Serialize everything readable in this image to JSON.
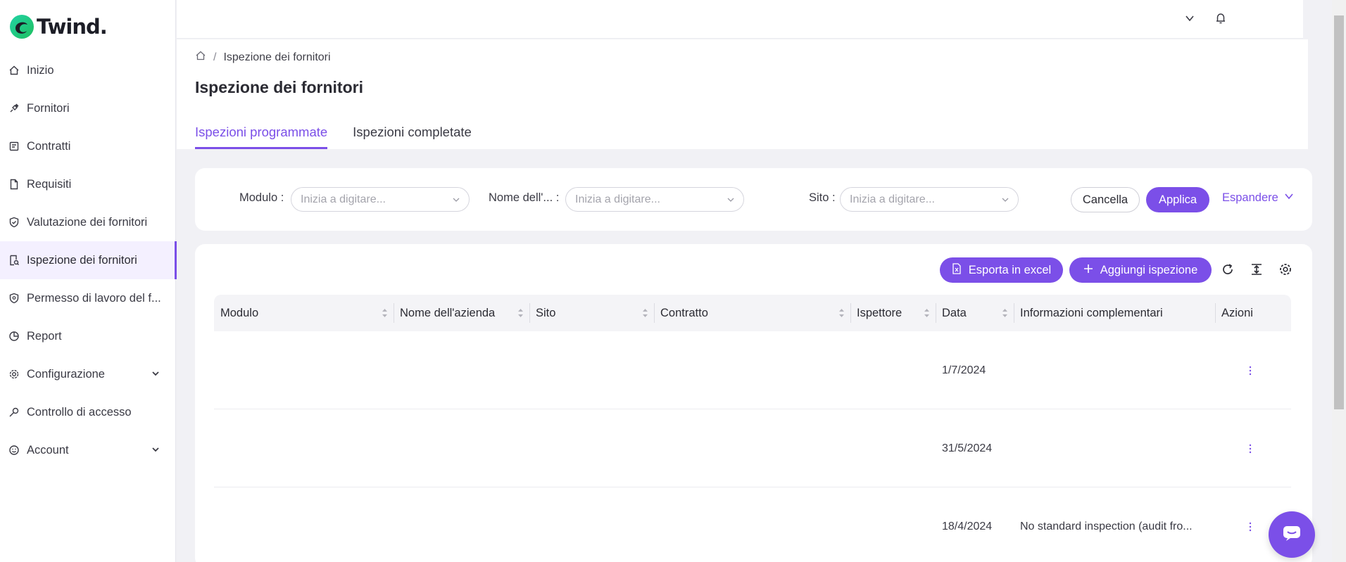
{
  "brand": {
    "name": "Twind.",
    "accent": "#7b4fe8"
  },
  "sidebar": {
    "items": [
      {
        "label": "Inizio",
        "icon": "home-icon"
      },
      {
        "label": "Fornitori",
        "icon": "plug-icon"
      },
      {
        "label": "Contratti",
        "icon": "document-icon"
      },
      {
        "label": "Requisiti",
        "icon": "file-icon"
      },
      {
        "label": "Valutazione dei fornitori",
        "icon": "shield-check-icon"
      },
      {
        "label": "Ispezione dei fornitori",
        "icon": "search-doc-icon",
        "active": true
      },
      {
        "label": "Permesso di lavoro del f...",
        "icon": "shield-icon"
      },
      {
        "label": "Report",
        "icon": "pie-chart-icon"
      },
      {
        "label": "Configurazione",
        "icon": "gear-icon",
        "expandable": true
      },
      {
        "label": "Controllo di accesso",
        "icon": "key-icon"
      },
      {
        "label": "Account",
        "icon": "smile-icon",
        "expandable": true
      }
    ]
  },
  "breadcrumb": {
    "current": "Ispezione dei fornitori"
  },
  "page": {
    "title": "Ispezione dei fornitori"
  },
  "tabs": [
    {
      "label": "Ispezioni programmate",
      "active": true
    },
    {
      "label": "Ispezioni completate",
      "active": false
    }
  ],
  "filters": {
    "modulo_label": "Modulo :",
    "nome_label": "Nome dell'... :",
    "sito_label": "Sito :",
    "placeholder": "Inizia a digitare...",
    "cancel": "Cancella",
    "apply": "Applica",
    "expand": "Espandere"
  },
  "toolbar": {
    "export": "Esporta in excel",
    "add": "Aggiungi ispezione"
  },
  "table": {
    "columns": [
      "Modulo",
      "Nome dell'azienda",
      "Sito",
      "Contratto",
      "Ispettore",
      "Data",
      "Informazioni complementari",
      "Azioni"
    ],
    "rows": [
      {
        "modulo": "",
        "azienda": "",
        "sito": "",
        "contratto": "",
        "ispettore": "",
        "data": "1/7/2024",
        "info": ""
      },
      {
        "modulo": "",
        "azienda": "",
        "sito": "",
        "contratto": "",
        "ispettore": "",
        "data": "31/5/2024",
        "info": ""
      },
      {
        "modulo": "",
        "azienda": "",
        "sito": "",
        "contratto": "",
        "ispettore": "",
        "data": "18/4/2024",
        "info": "No standard inspection (audit fro..."
      }
    ]
  }
}
